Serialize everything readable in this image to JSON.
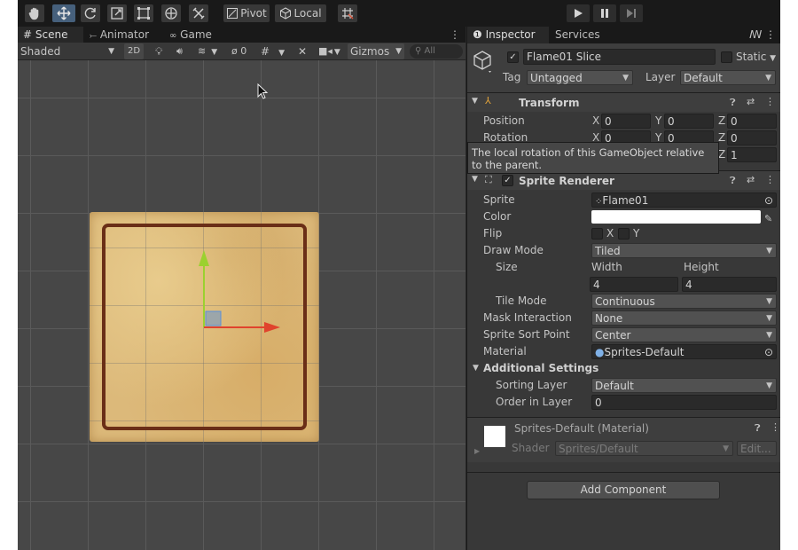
{
  "toolbar": {
    "tools": [
      "hand-tool",
      "move-tool",
      "rotate-tool",
      "scale-tool",
      "rect-tool",
      "transform-tool",
      "custom-tool"
    ],
    "pivot_label": "Pivot",
    "local_label": "Local",
    "snap_icon": "grid-snap-icon",
    "play_controls": [
      "play",
      "pause",
      "step"
    ]
  },
  "scene": {
    "tabs": [
      {
        "label": "Scene",
        "icon": "grid-icon"
      },
      {
        "label": "Animator",
        "icon": "animator-icon"
      },
      {
        "label": "Game",
        "icon": "gamepad-icon"
      }
    ],
    "shading_mode": "Shaded",
    "toggle_2d": "2D",
    "hidden_count": "0",
    "gizmos_label": "Gizmos",
    "search_placeholder": "All"
  },
  "inspector": {
    "tabs": [
      {
        "label": "Inspector",
        "icon": "info-icon"
      },
      {
        "label": "Services"
      }
    ],
    "object_name": "Flame01 Slice",
    "static_label": "Static",
    "tag_label": "Tag",
    "tag_value": "Untagged",
    "layer_label": "Layer",
    "layer_value": "Default",
    "transform": {
      "title": "Transform",
      "position_label": "Position",
      "rotation_label": "Rotation",
      "position": {
        "x": "0",
        "y": "0",
        "z": "0"
      },
      "rotation": {
        "x": "0",
        "y": "0",
        "z": "0"
      },
      "scale": {
        "z": "1"
      },
      "tooltip": "The local rotation of this GameObject relative to the parent."
    },
    "sprite_renderer": {
      "title": "Sprite Renderer",
      "sprite_label": "Sprite",
      "sprite_value": "Flame01",
      "color_label": "Color",
      "color_value": "#ffffff",
      "flip_label": "Flip",
      "flip_x": "X",
      "flip_y": "Y",
      "draw_mode_label": "Draw Mode",
      "draw_mode_value": "Tiled",
      "size_label": "Size",
      "width_label": "Width",
      "height_label": "Height",
      "width_value": "4",
      "height_value": "4",
      "tile_mode_label": "Tile Mode",
      "tile_mode_value": "Continuous",
      "mask_label": "Mask Interaction",
      "mask_value": "None",
      "sort_point_label": "Sprite Sort Point",
      "sort_point_value": "Center",
      "material_label": "Material",
      "material_value": "Sprites-Default",
      "additional_label": "Additional Settings",
      "sorting_layer_label": "Sorting Layer",
      "sorting_layer_value": "Default",
      "order_label": "Order in Layer",
      "order_value": "0"
    },
    "material": {
      "title": "Sprites-Default (Material)",
      "shader_label": "Shader",
      "shader_value": "Sprites/Default",
      "edit_label": "Edit..."
    },
    "add_component": "Add Component"
  },
  "colors": {
    "accent": "#46607c",
    "x_axis": "#e0432d",
    "y_axis": "#9bd12f"
  }
}
